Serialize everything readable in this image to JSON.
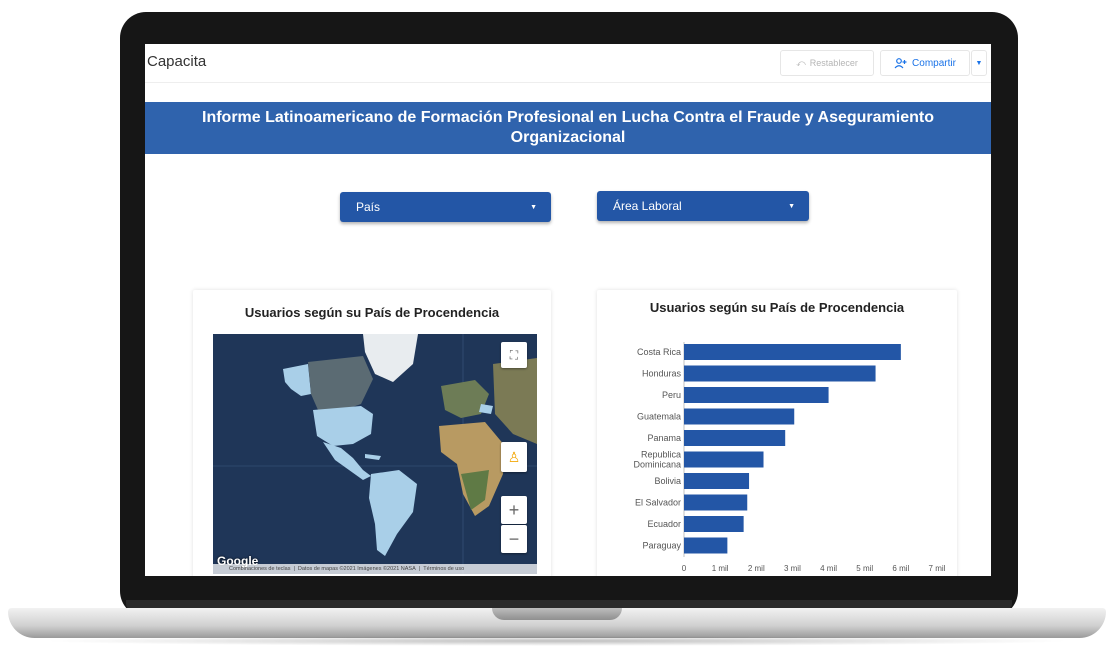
{
  "header": {
    "app_title": "Capacita",
    "reset_label": "Restablecer",
    "share_label": "Compartir"
  },
  "banner": {
    "title_line1": "Informe Latinoamericano de Formación Profesional en Lucha Contra el Fraude y Aseguramiento",
    "title_line2": "Organizacional"
  },
  "filters": {
    "country_label": "País",
    "area_label": "Área Laboral"
  },
  "map_card": {
    "title": "Usuarios según su País de Procendencia",
    "google_label": "Google",
    "footer": {
      "shortcuts": "Combinaciones de teclas",
      "map_data": "Datos de mapas ©2021 Imágenes ©2021 NASA",
      "terms": "Términos de uso"
    },
    "zoom_in_label": "+",
    "zoom_out_label": "−"
  },
  "bar_card": {
    "title": "Usuarios según su País de Procendencia"
  },
  "chart_data": {
    "type": "bar",
    "orientation": "horizontal",
    "title": "Usuarios según su País de Procendencia",
    "categories": [
      "Costa Rica",
      "Honduras",
      "Peru",
      "Guatemala",
      "Panama",
      "Republica Dominicana",
      "Bolivia",
      "El Salvador",
      "Ecuador",
      "Paraguay"
    ],
    "values": [
      6000,
      5300,
      4000,
      3050,
      2800,
      2200,
      1800,
      1750,
      1650,
      1200
    ],
    "xlim": [
      0,
      7000
    ],
    "xticks": [
      0,
      1000,
      2000,
      3000,
      4000,
      5000,
      6000,
      7000
    ],
    "xtick_labels": [
      "0",
      "1 mil",
      "2 mil",
      "3 mil",
      "4 mil",
      "5 mil",
      "6 mil",
      "7 mil"
    ],
    "bar_color": "#2356a6",
    "grid": false
  }
}
